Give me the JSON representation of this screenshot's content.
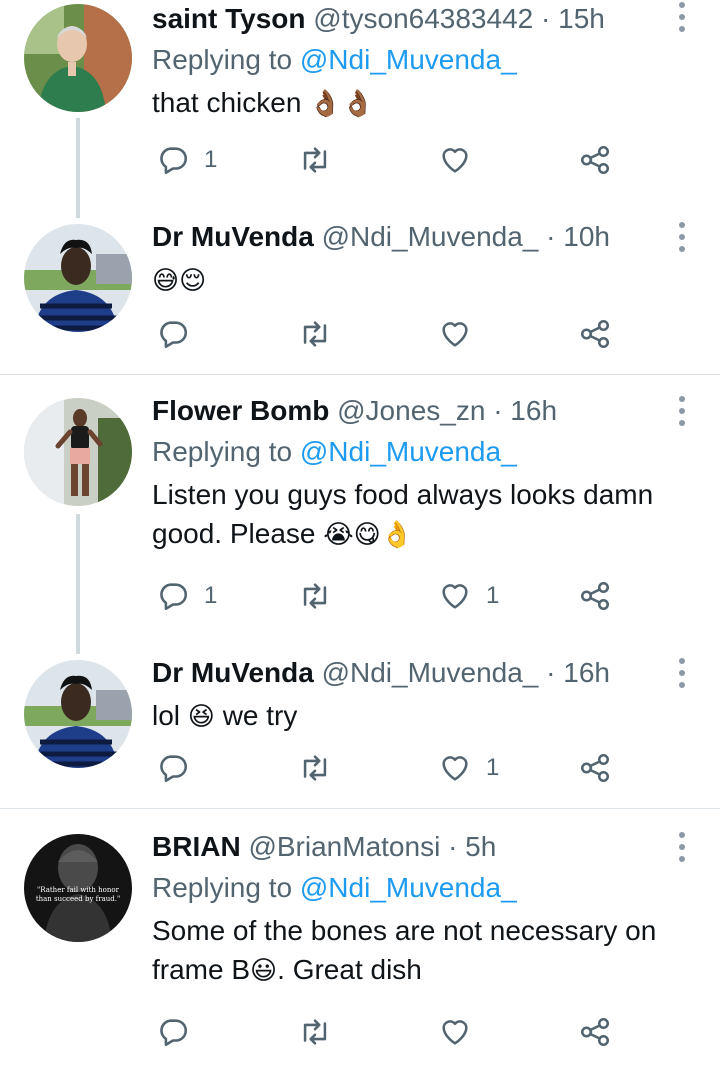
{
  "tweets": [
    {
      "name": "saint Tyson",
      "handle": "@tyson64383442",
      "time": "· 15h",
      "replying_label": "Replying to",
      "replying_handle": "@Ndi_Muvenda_",
      "text": "that chicken",
      "emoji": "👌🏾👌🏾",
      "replies": "1",
      "retweets": "",
      "likes": "",
      "avatar_icon": "avatar-man-outdoors"
    },
    {
      "name": "Dr MuVenda",
      "handle": "@Ndi_Muvenda_",
      "time": "· 10h",
      "text": "",
      "emoji": "😅😌",
      "replies": "",
      "retweets": "",
      "likes": "",
      "avatar_icon": "avatar-man-striped-shirt"
    },
    {
      "name": "Flower Bomb",
      "handle": "@Jones_zn",
      "time": "· 16h",
      "replying_label": "Replying to",
      "replying_handle": "@Ndi_Muvenda_",
      "text": "Listen you guys food always looks damn good. Please",
      "emoji": "😭😋👌",
      "replies": "1",
      "retweets": "",
      "likes": "1",
      "avatar_icon": "avatar-woman-posing"
    },
    {
      "name": "Dr MuVenda",
      "handle": "@Ndi_Muvenda_",
      "time": "· 16h",
      "text_before": "lol",
      "emoji": "😆",
      "text_after": "we try",
      "replies": "",
      "retweets": "",
      "likes": "1",
      "avatar_icon": "avatar-man-striped-shirt"
    },
    {
      "name": "BRIAN",
      "handle": "@BrianMatonsi",
      "time": "· 5h",
      "replying_label": "Replying to",
      "replying_handle": "@Ndi_Muvenda_",
      "text_before": "Some of the bones are not necessary on frame B",
      "emoji": "😃",
      "text_after": ". Great dish",
      "avatar_quote": "\"Rather fail with honor than succeed by fraud.\"",
      "replies": "",
      "retweets": "",
      "likes": "",
      "avatar_icon": "avatar-statue-quote"
    }
  ],
  "colors": {
    "link": "#1d9bf0",
    "secondary_text": "#536471",
    "primary_text": "#0f1419",
    "thread_line": "#cfd9de",
    "divider": "#dfe4e8"
  },
  "icons": [
    "reply-icon",
    "retweet-icon",
    "like-icon",
    "share-icon",
    "more-options-icon"
  ]
}
